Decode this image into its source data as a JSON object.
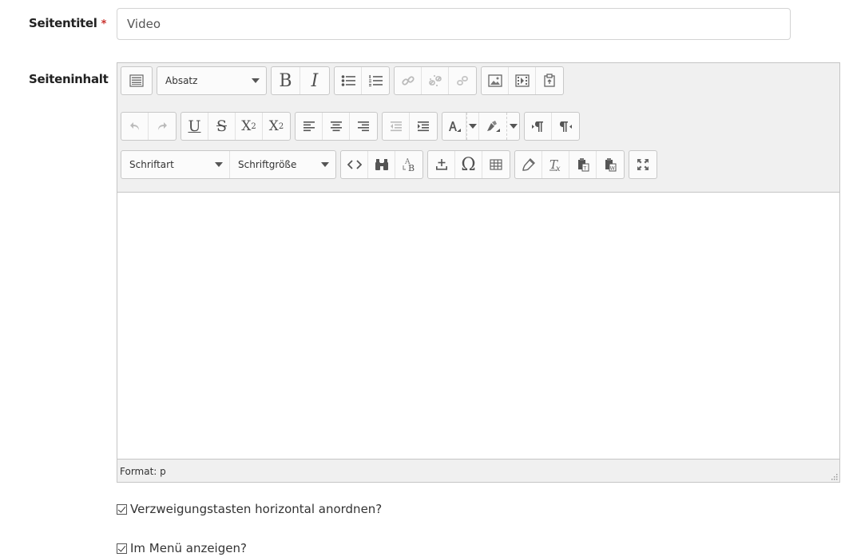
{
  "form": {
    "title_label": "Seitentitel",
    "required_marker": "*",
    "title_value": "Video",
    "content_label": "Seiteninhalt"
  },
  "toolbar": {
    "format_select": "Absatz",
    "bold": "B",
    "italic": "I",
    "underline": "U",
    "strikethrough": "S",
    "subscript": "X",
    "subscript_suffix": "2",
    "superscript": "X",
    "superscript_suffix": "2",
    "font_family_select": "Schriftart",
    "font_size_select": "Schriftgröße",
    "omega": "Ω"
  },
  "editor": {
    "status": "Format: p"
  },
  "options": {
    "horizontal_buttons": "Verzweigungstasten horizontal anordnen?",
    "show_in_menu": "Im Menü anzeigen?"
  },
  "colors": {
    "required": "#c9302c",
    "toolbar_bg": "#f0f0f0",
    "border": "#c5c5c5"
  }
}
